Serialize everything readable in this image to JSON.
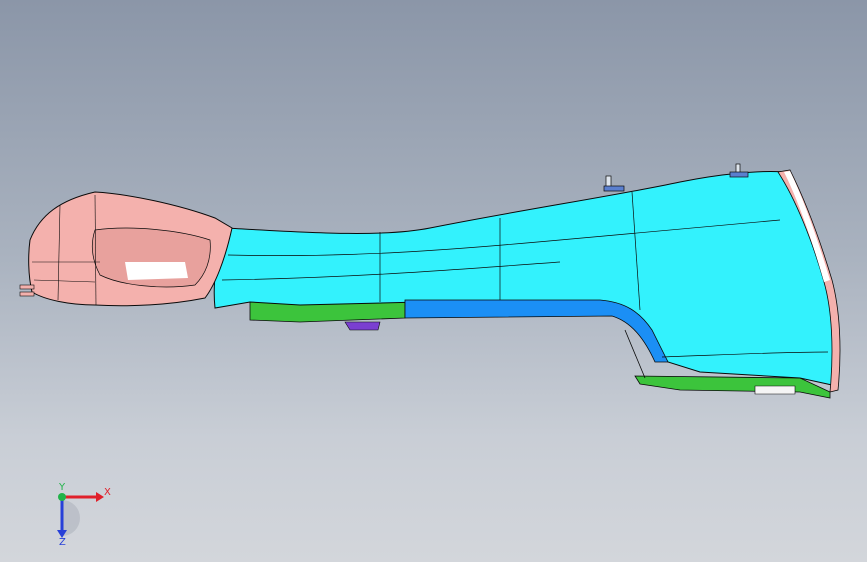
{
  "viewport": {
    "background_top": "#8b96a8",
    "background_bottom": "#d3d6db"
  },
  "model": {
    "colors": {
      "pink_part": "#f4b1ad",
      "pink_dark": "#d98a88",
      "cyan_part": "#33f2fd",
      "cyan_dark": "#1fb7c4",
      "blue_part": "#1b8ff5",
      "green_part": "#3cc43c",
      "purple_part": "#7a3fd1",
      "edge": "#0a0a0a"
    }
  },
  "triad": {
    "x_label": "X",
    "y_label": "Y",
    "z_label": "Z",
    "x_color": "#e0202a",
    "y_color": "#22b34a",
    "z_color": "#2740d8"
  }
}
